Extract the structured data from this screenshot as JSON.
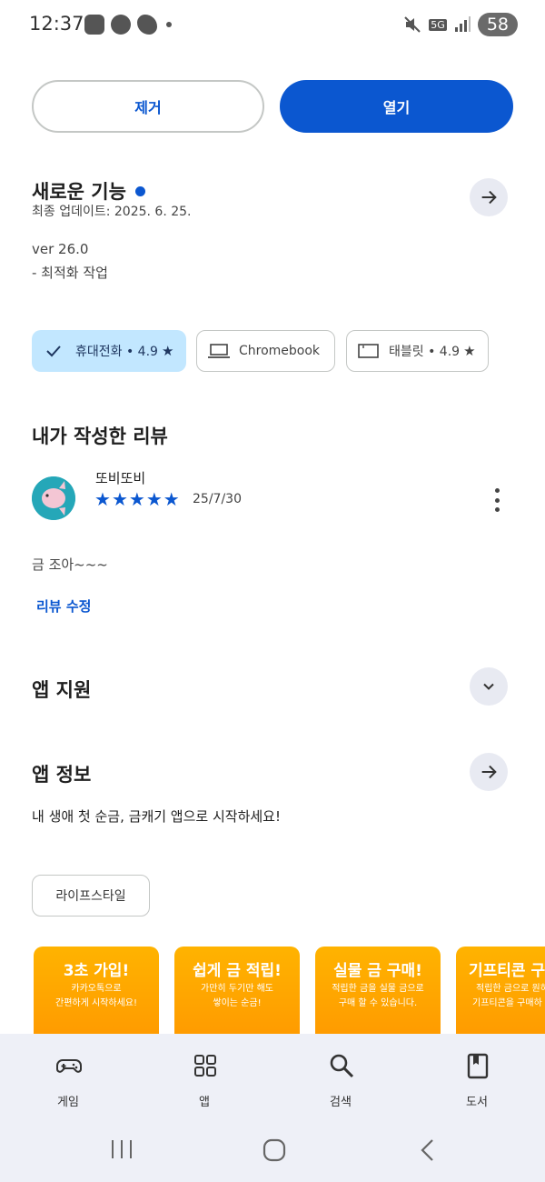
{
  "status_bar": {
    "time": "12:37",
    "network": "5G",
    "battery": "58"
  },
  "actions": {
    "remove_label": "제거",
    "open_label": "열기"
  },
  "whats_new": {
    "title": "새로운 기능",
    "updated": "최종 업데이트: 2025. 6. 25.",
    "version": "ver 26.0",
    "note": "- 최적화 작업"
  },
  "device_chips": [
    {
      "label": "휴대전화 • 4.9",
      "selected": true,
      "icon": "check-icon"
    },
    {
      "label": "Chromebook",
      "selected": false,
      "icon": "laptop-icon"
    },
    {
      "label": "태블릿 • 4.9",
      "selected": false,
      "icon": "tablet-icon"
    }
  ],
  "my_review": {
    "title": "내가 작성한 리뷰",
    "reviewer": "또비또비",
    "rating": 5,
    "date": "25/7/30",
    "text": "금 조아~~~",
    "edit_label": "리뷰 수정"
  },
  "app_support": {
    "title": "앱 지원"
  },
  "app_info": {
    "title": "앱 정보",
    "description": "내 생애 첫 순금, 금캐기 앱으로 시작하세요!",
    "category": "라이프스타일"
  },
  "screenshots": [
    {
      "headline": "3초 가입!",
      "line1": "카카오톡으로",
      "line2": "간편하게 시작하세요!"
    },
    {
      "headline": "쉽게 금 적립!",
      "line1": "가만히 두기만 해도",
      "line2": "쌓이는 순금!"
    },
    {
      "headline": "실물 금 구매!",
      "line1": "적립한 금을 실물 금으로",
      "line2": "구매 할 수 있습니다."
    },
    {
      "headline": "기프티콘 구",
      "line1": "적립한 금으로 원하",
      "line2": "기프티콘을 구매하"
    }
  ],
  "bottom_nav": [
    {
      "label": "게임",
      "icon": "gamepad-icon"
    },
    {
      "label": "앱",
      "icon": "apps-grid-icon"
    },
    {
      "label": "검색",
      "icon": "search-icon"
    },
    {
      "label": "도서",
      "icon": "book-icon"
    }
  ],
  "colors": {
    "primary": "#0b57d0",
    "selected_chip": "#c2e7ff",
    "nav_bg": "#eef0f7",
    "screenshot_bg": "#ffa000"
  }
}
